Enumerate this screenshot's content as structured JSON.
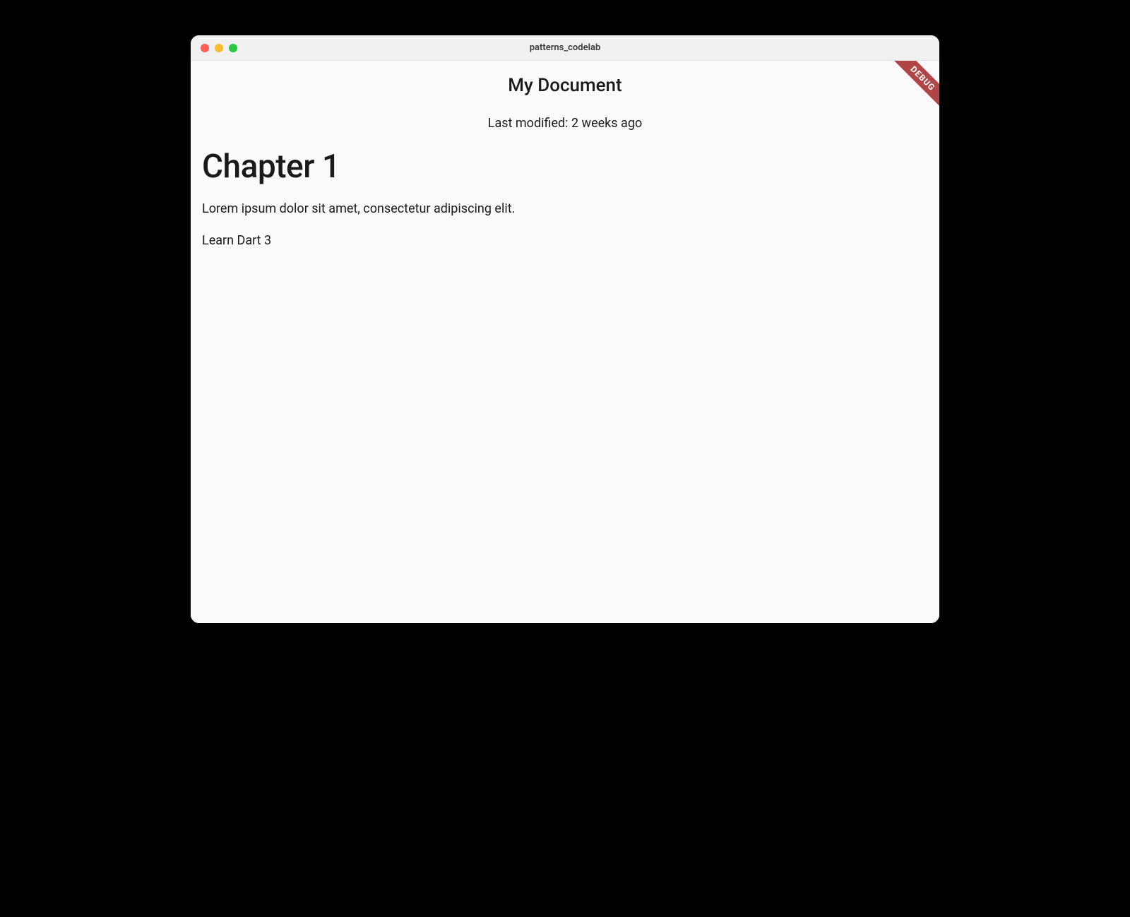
{
  "window": {
    "title": "patterns_codelab"
  },
  "debug": {
    "label": "DEBUG"
  },
  "document": {
    "title": "My Document",
    "subtitle": "Last modified: 2 weeks ago"
  },
  "content": {
    "heading": "Chapter 1",
    "paragraph": "Lorem ipsum dolor sit amet, consectetur adipiscing elit.",
    "link": "Learn Dart 3"
  }
}
